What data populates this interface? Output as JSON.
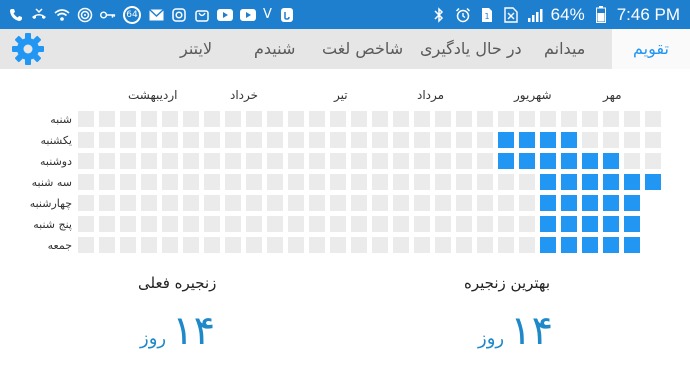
{
  "status_bar": {
    "time": "7:46 PM",
    "battery": "64%",
    "notification_badge": "64",
    "sim_label": "1",
    "notification_letter": "V"
  },
  "tabs": [
    {
      "label": "تقویم",
      "active": true
    },
    {
      "label": "میدانم",
      "active": false
    },
    {
      "label": "در حال یادگیری",
      "active": false
    },
    {
      "label": "شاخص لغت",
      "active": false
    },
    {
      "label": "شنیدم",
      "active": false
    },
    {
      "label": "لایتنر",
      "active": false
    }
  ],
  "calendar": {
    "months": [
      "مهر",
      "شهریور",
      "مرداد",
      "تیر",
      "خرداد",
      "اردیبهشت"
    ],
    "days": [
      "شنبه",
      "یکشنبه",
      "دوشنبه",
      "سه شنبه",
      "چهارشنبه",
      "پنج شنبه",
      "جمعه"
    ],
    "grid": [
      "0000000000000000000000000000",
      "0000000000000000000011110000",
      "0000000000000000000011111100",
      "0000000000000000000000111111",
      "0000000000000000000000111111",
      "0000000000000000000000111111",
      "0000000000000000000000111111"
    ],
    "empty_days": [
      [
        0,
        0
      ],
      [
        6,
        0
      ],
      [
        5,
        0
      ],
      [
        4,
        0
      ]
    ],
    "active_color": "#2196f3",
    "empty_color": "#ebebeb"
  },
  "best_streak": {
    "title": "بهترین زنجیره",
    "value": "۱۴",
    "unit": "روز"
  },
  "current_streak": {
    "title": "زنجیره فعلی",
    "value": "۱۴",
    "unit": "روز"
  }
}
